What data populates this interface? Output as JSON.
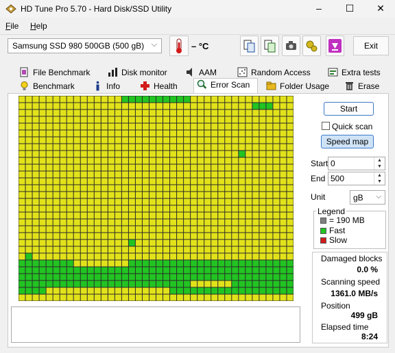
{
  "window": {
    "title": "HD Tune Pro 5.70 - Hard Disk/SSD Utility"
  },
  "menu": [
    {
      "label": "File",
      "key": "F",
      "rest": "ile"
    },
    {
      "label": "Help",
      "key": "H",
      "rest": "elp"
    }
  ],
  "toolbar": {
    "drive": "Samsung SSD 980 500GB (500 gB)",
    "temperature": "– °C",
    "exit_label": "Exit"
  },
  "tabs_row1": [
    {
      "label": "File Benchmark",
      "icon": "file-benchmark-icon"
    },
    {
      "label": "Disk monitor",
      "icon": "disk-monitor-icon"
    },
    {
      "label": "AAM",
      "icon": "speaker-icon"
    },
    {
      "label": "Random Access",
      "icon": "random-access-icon"
    },
    {
      "label": "Extra tests",
      "icon": "extra-tests-icon"
    }
  ],
  "tabs_row2": [
    {
      "label": "Benchmark",
      "icon": "lightbulb-icon"
    },
    {
      "label": "Info",
      "icon": "info-icon"
    },
    {
      "label": "Health",
      "icon": "health-cross-icon"
    },
    {
      "label": "Error Scan",
      "icon": "magnifier-icon",
      "active": true
    },
    {
      "label": "Folder Usage",
      "icon": "folder-icon"
    },
    {
      "label": "Erase",
      "icon": "trash-icon"
    }
  ],
  "scan": {
    "start_button": "Start",
    "quick_scan_label": "Quick scan",
    "quick_scan_checked": false,
    "speed_map_button": "Speed map",
    "start_label": "Start",
    "start_value": "0",
    "end_label": "End",
    "end_value": "500",
    "unit_label": "Unit",
    "unit_value": "gB"
  },
  "legend": {
    "title": "Legend",
    "items": [
      {
        "label": "= 190 MB",
        "color": "#808080"
      },
      {
        "label": "Fast",
        "color": "#22c422"
      },
      {
        "label": "Slow",
        "color": "#d21a1a"
      }
    ]
  },
  "stats": {
    "damaged_label": "Damaged blocks",
    "damaged_value": "0.0 %",
    "speed_label": "Scanning speed",
    "speed_value": "1361.0 MB/s",
    "position_label": "Position",
    "position_value": "499 gB",
    "elapsed_label": "Elapsed time",
    "elapsed_value": "8:24"
  },
  "block_colors": {
    "yellow": "#e2e21a",
    "green": "#22c422"
  }
}
